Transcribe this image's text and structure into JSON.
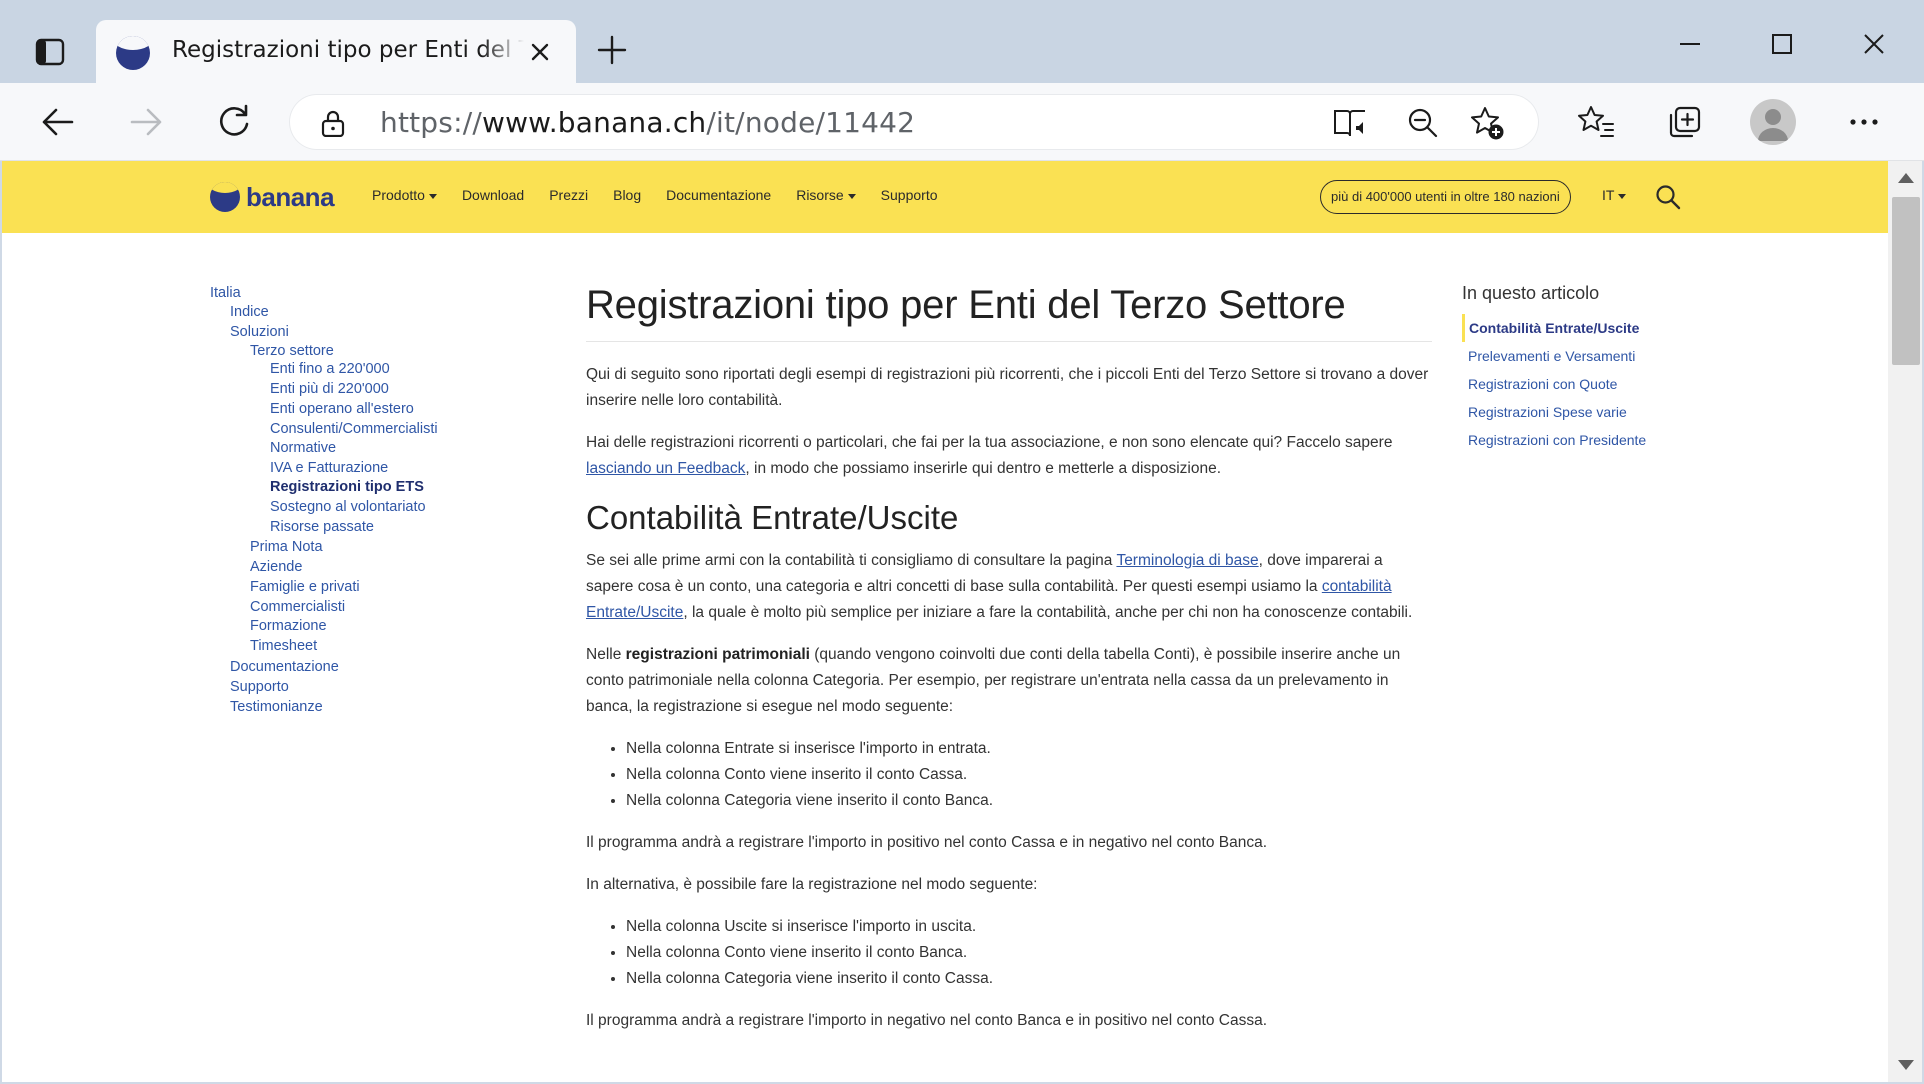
{
  "browser": {
    "tab_title": "Registrazioni tipo per Enti del Terzo Settore",
    "url": {
      "scheme": "https://",
      "host": "www.banana.ch",
      "path": "/it/node/11442"
    }
  },
  "site": {
    "brand": "banana",
    "brand_color": "#2c3a86",
    "header_color": "#fae153",
    "nav": [
      {
        "label": "Prodotto",
        "dropdown": true
      },
      {
        "label": "Download",
        "dropdown": false
      },
      {
        "label": "Prezzi",
        "dropdown": false
      },
      {
        "label": "Blog",
        "dropdown": false
      },
      {
        "label": "Documentazione",
        "dropdown": false
      },
      {
        "label": "Risorse",
        "dropdown": true
      },
      {
        "label": "Supporto",
        "dropdown": false
      }
    ],
    "users_badge": "più di 400'000 utenti in oltre 180 nazioni",
    "language": "IT"
  },
  "sidebar": {
    "items": [
      {
        "label": "Italia"
      },
      {
        "label": "Indice"
      },
      {
        "label": "Soluzioni"
      },
      {
        "label": "Terzo settore"
      },
      {
        "label": "Enti fino a 220'000"
      },
      {
        "label": "Enti più di 220'000"
      },
      {
        "label": "Enti operano all'estero"
      },
      {
        "label": "Consulenti/Commercialisti"
      },
      {
        "label": "Normative"
      },
      {
        "label": "IVA e Fatturazione"
      },
      {
        "label": "Registrazioni tipo ETS",
        "active": true
      },
      {
        "label": "Sostegno al volontariato"
      },
      {
        "label": "Risorse passate"
      },
      {
        "label": "Prima Nota"
      },
      {
        "label": "Aziende"
      },
      {
        "label": "Famiglie e privati"
      },
      {
        "label": "Commercialisti"
      },
      {
        "label": "Formazione"
      },
      {
        "label": "Timesheet"
      },
      {
        "label": "Documentazione"
      },
      {
        "label": "Supporto"
      },
      {
        "label": "Testimonianze"
      }
    ]
  },
  "article": {
    "title": "Registrazioni tipo per Enti del Terzo Settore",
    "intro": "Qui di seguito sono riportati degli esempi di registrazioni più ricorrenti, che i piccoli Enti del Terzo Settore si trovano a dover inserire nelle loro contabilità.",
    "feedback_pre": "Hai delle registrazioni ricorrenti o particolari, che fai per la tua associazione, e non sono elencate qui? Faccelo sapere ",
    "feedback_link": "lasciando un Feedback",
    "feedback_post": ", in modo che possiamo inserirle qui dentro e metterle a disposizione.",
    "section1_title": "Contabilità Entrate/Uscite",
    "s1_p1_pre": "Se sei alle prime armi con la contabilità ti consigliamo di consultare la pagina ",
    "s1_p1_link1": "Terminologia di base",
    "s1_p1_mid": ", dove imparerai a sapere cosa è un conto, una categoria e altri concetti di base sulla contabilità. Per questi esempi usiamo la ",
    "s1_p1_link2": "contabilità Entrate/Uscite",
    "s1_p1_post": ", la quale è molto più semplice per iniziare a fare la contabilità, anche per chi non ha conoscenze contabili.",
    "s1_p2_pre": "Nelle ",
    "s1_p2_bold": "registrazioni patrimoniali",
    "s1_p2_post": " (quando vengono coinvolti due conti della tabella Conti), è possibile inserire anche un conto patrimoniale nella colonna Categoria. Per esempio, per registrare un'entrata nella cassa da un prelevamento in banca, la registrazione si esegue nel modo seguente:",
    "list1": [
      "Nella colonna Entrate si inserisce l'importo in entrata.",
      "Nella colonna Conto viene inserito il conto Cassa.",
      "Nella colonna Categoria viene inserito il conto Banca."
    ],
    "s1_p3": "Il programma andrà a registrare l'importo in positivo nel conto Cassa e in negativo nel conto Banca.",
    "s1_p4": "In alternativa, è possibile fare la registrazione nel modo seguente:",
    "list2": [
      "Nella colonna Uscite si inserisce l'importo in uscita.",
      "Nella colonna Conto viene inserito il conto Banca.",
      "Nella colonna Categoria viene inserito il conto Cassa."
    ],
    "s1_p5": "Il programma andrà a registrare l'importo in negativo nel conto Banca e in positivo nel conto Cassa."
  },
  "toc": {
    "title": "In questo articolo",
    "items": [
      {
        "label": "Contabilità Entrate/Uscite",
        "active": true
      },
      {
        "label": "Prelevamenti e Versamenti"
      },
      {
        "label": "Registrazioni con Quote"
      },
      {
        "label": "Registrazioni Spese varie"
      },
      {
        "label": "Registrazioni con Presidente"
      }
    ]
  }
}
